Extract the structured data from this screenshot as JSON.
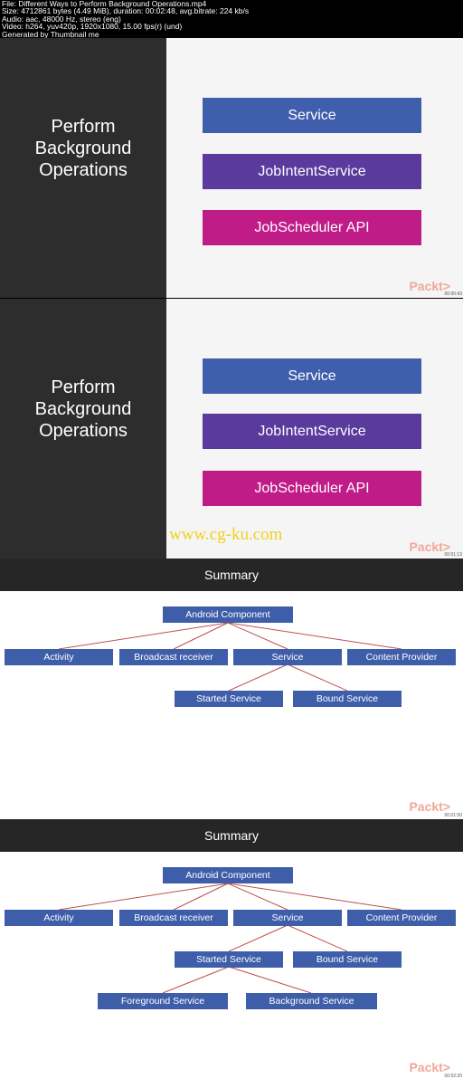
{
  "metadata": [
    "File: Different Ways to Perform Background Operations.mp4",
    "Size: 4712861 bytes (4.49 MiB), duration: 00:02:48, avg.bitrate: 224 kb/s",
    "Audio: aac, 48000 Hz, stereo (eng)",
    "Video: h264, yuv420p, 1920x1080, 15.00 fps(r) (und)",
    "Generated by Thumbnail me"
  ],
  "slide_title_lines": [
    "Perform",
    "Background",
    "Operations"
  ],
  "options": [
    {
      "label": "Service",
      "color": "#3f5fad"
    },
    {
      "label": "JobIntentService",
      "color": "#5a3a9c"
    },
    {
      "label": "JobScheduler API",
      "color": "#c01c88"
    }
  ],
  "logo": "Packt>",
  "timestamps": [
    "00:00:43",
    "00:01:13",
    "00:01:50",
    "00:02:20"
  ],
  "watermark": "www.cg-ku.com",
  "summary_title": "Summary",
  "diagram": {
    "root": "Android Component",
    "children": [
      "Activity",
      "Broadcast receiver",
      "Service",
      "Content Provider"
    ],
    "service_children": [
      "Started Service",
      "Bound Service"
    ],
    "started_children": [
      "Foreground Service",
      "Background Service"
    ],
    "node_color": "#3e5ea9",
    "line_color": "#c0504d"
  }
}
